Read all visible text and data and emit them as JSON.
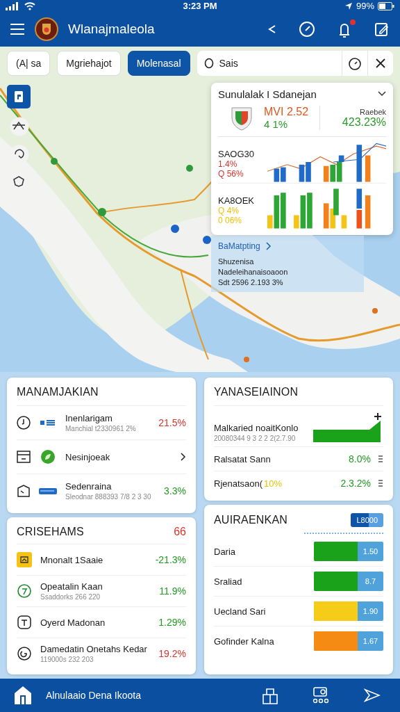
{
  "status_bar": {
    "time": "3:23 PM",
    "battery": "99%"
  },
  "app_bar": {
    "title": "Wlanajmaleola",
    "notification_dot": true
  },
  "filters": [
    {
      "label": "(A| sa",
      "selected": false
    },
    {
      "label": "Mgriehajot",
      "selected": false
    },
    {
      "label": "Molenasal",
      "selected": true
    }
  ],
  "search": {
    "value": "Sais"
  },
  "summary_card": {
    "title": "Sunulalak I Sdanejan",
    "primary": "MVI 2.52",
    "primary_change": "4 1%",
    "secondary_label": "Raebek",
    "secondary_value": "423.23%",
    "sections": [
      {
        "label": "SAOG30",
        "value": "1.4%",
        "sub": "Q 56%",
        "color": "#d9342b"
      },
      {
        "label": "KA8OEK",
        "value": "Q 4%",
        "sub": "0 06%",
        "color": "#f0c000"
      }
    ]
  },
  "map_info": {
    "link": "BaMatpting",
    "lines": [
      "Shuzenisa",
      "Nadeleihanaisoaoon",
      "Sdt 2596 2.193 3%"
    ]
  },
  "card_1": {
    "title": "MANAMJAKIAN",
    "rows": [
      {
        "kind": "metric",
        "title": "Inenlarigam",
        "subtitle": "Manchial t2330961 2%",
        "value": "21.5%",
        "color": "#d9342b"
      },
      {
        "kind": "link",
        "title": "Nesinjoeak"
      },
      {
        "kind": "metric",
        "title": "Sedenraina",
        "subtitle": "Sleodnar 888393 7/8 2 3 30",
        "value": "3.3%",
        "color": "#1f9a1f"
      }
    ]
  },
  "card_2": {
    "title": "YANASEIAINON",
    "trend_item": {
      "title": "Malkaried noaitKonlo",
      "subtitle": "20080344 9 3 2 2 2(2.7.90"
    },
    "rows": [
      {
        "label": "Ralsatat Sann",
        "value": "8.0%",
        "color": "#1f9a1f"
      },
      {
        "label": "Rjenatsaon(",
        "note": "10%",
        "value": "2.3.2%",
        "color": "#1f9a1f"
      }
    ]
  },
  "card_3": {
    "title": "CRISEHAMS",
    "count": "66",
    "rows": [
      {
        "title": "Mnonalt 1Saaie",
        "value": "-21.3%",
        "color": "#1f9a1f"
      },
      {
        "title": "Opeatalin Kaan",
        "subtitle": "Ssaddorks 266 220",
        "value": "11.9%",
        "color": "#1f9a1f"
      },
      {
        "title": "Oyerd Madonan",
        "value": "1.29%",
        "color": "#1f9a1f"
      },
      {
        "title": "Damedatin Onetahs Kedar",
        "subtitle": "119000s 232 203",
        "value": "19.2%",
        "color": "#d9342b"
      }
    ]
  },
  "card_4": {
    "title": "AUIRAENKAN",
    "badge": "L8000",
    "bars": [
      {
        "label": "Daria",
        "value": "1.50",
        "level": 0.63,
        "color": "#1aa31a"
      },
      {
        "label": "Sraliad",
        "value": "8.7",
        "level": 0.63,
        "color": "#1aa31a"
      },
      {
        "label": "Uecland Sari",
        "value": "1.90",
        "level": 0.63,
        "color": "#f5cc17"
      },
      {
        "label": "Gofinder Kalna",
        "value": "1.67",
        "level": 0.63,
        "color": "#f58b12"
      }
    ]
  },
  "bottom_nav": {
    "title": "Alnulaaio Dena Ikoota"
  }
}
